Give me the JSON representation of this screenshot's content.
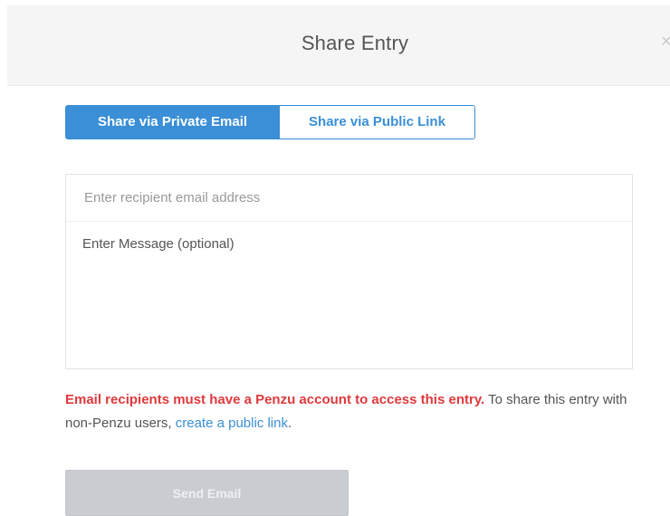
{
  "modal": {
    "title": "Share Entry",
    "close_symbol": "×"
  },
  "tabs": [
    {
      "label": "Share via Private Email",
      "active": true
    },
    {
      "label": "Share via Public Link",
      "active": false
    }
  ],
  "form": {
    "email_placeholder": "Enter recipient email address",
    "email_value": "",
    "message_placeholder": "Enter Message (optional)",
    "message_value": ""
  },
  "notice": {
    "warning": "Email recipients must have a Penzu account to access this entry.",
    "text": " To share this entry with non-Penzu users, ",
    "link_label": "create a public link",
    "end": "."
  },
  "send_button": {
    "label": "Send Email",
    "enabled": false
  },
  "colors": {
    "accent": "#3a8fd6",
    "warning": "#e0393c",
    "header_bg": "#f5f5f5",
    "disabled_button": "#c9cdd2"
  },
  "icons": {
    "close": "close-icon"
  }
}
